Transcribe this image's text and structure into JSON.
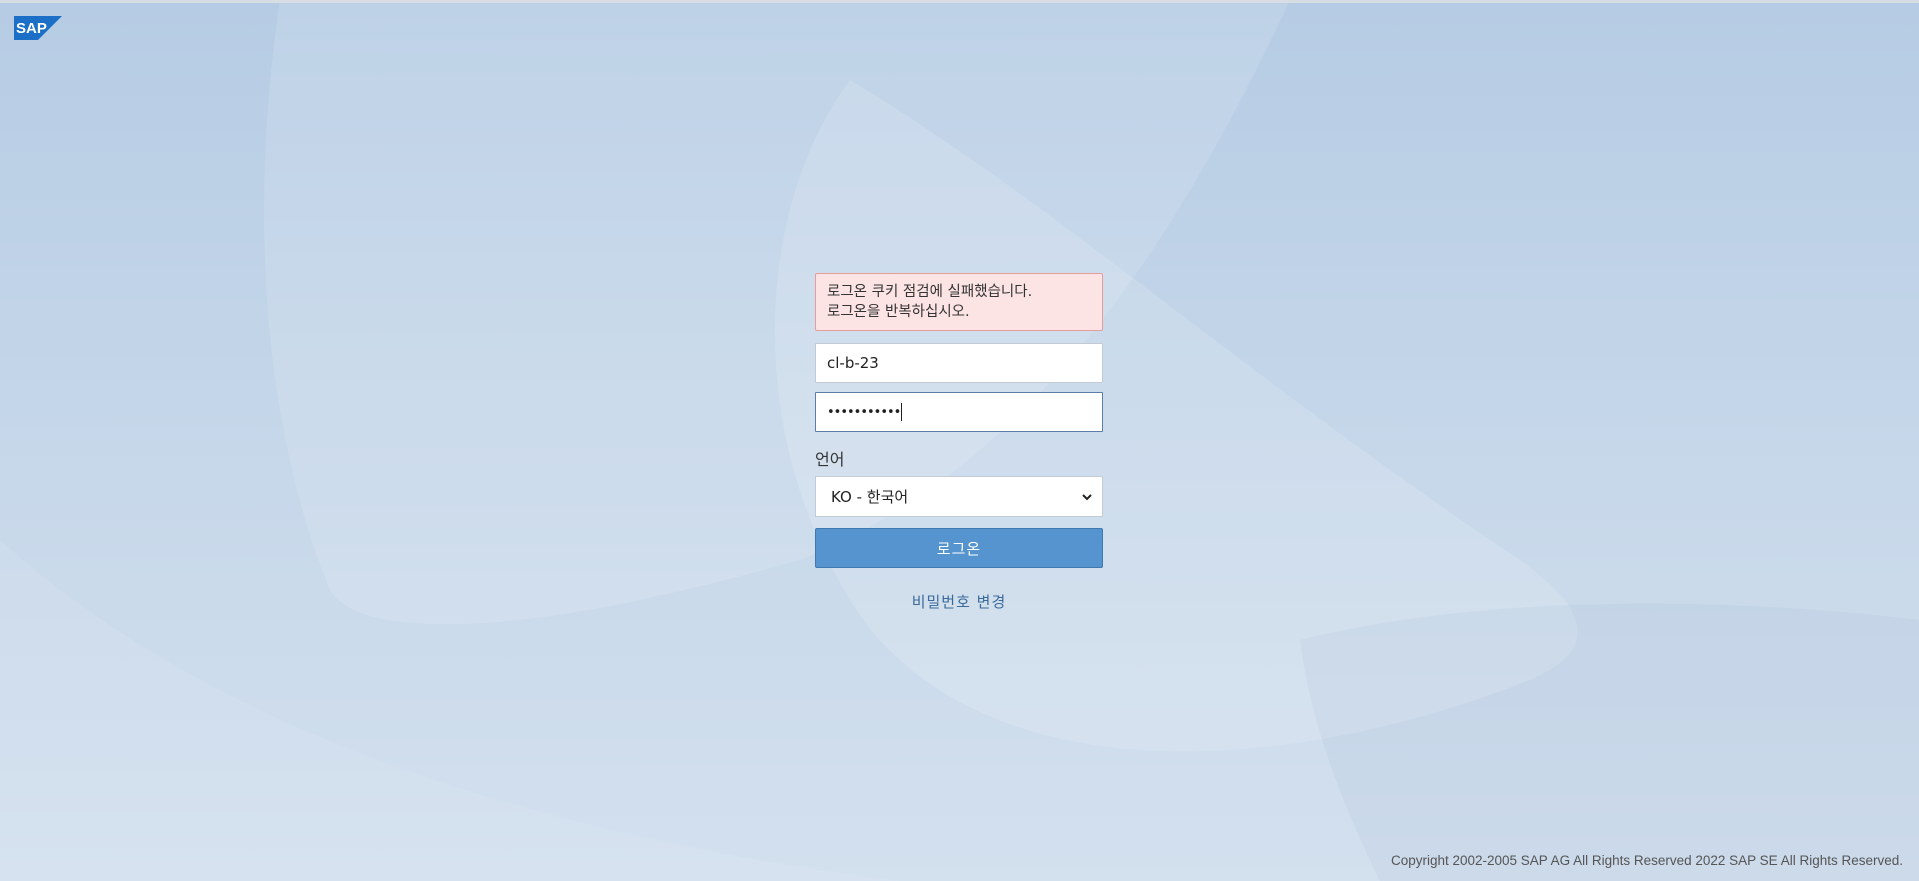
{
  "brand": {
    "logo_text": "SAP",
    "color": "#1b6fc7"
  },
  "login": {
    "error_lines": [
      "로그온 쿠키 점검에 실패했습니다.",
      "로그온을 반복하십시오."
    ],
    "username_value": "cl-b-23",
    "password_value": "•••••••••••",
    "language_label": "언어",
    "language_selected": "KO - 한국어",
    "login_button_label": "로그온",
    "change_password_link": "비밀번호 변경"
  },
  "footer": {
    "copyright": "Copyright 2002-2005 SAP AG All Rights Reserved 2022 SAP SE All Rights Reserved."
  },
  "colors": {
    "primary_button": "#5594cf",
    "error_bg": "#fde4e4",
    "error_border": "#e79c9c",
    "link": "#3b6a9a"
  }
}
